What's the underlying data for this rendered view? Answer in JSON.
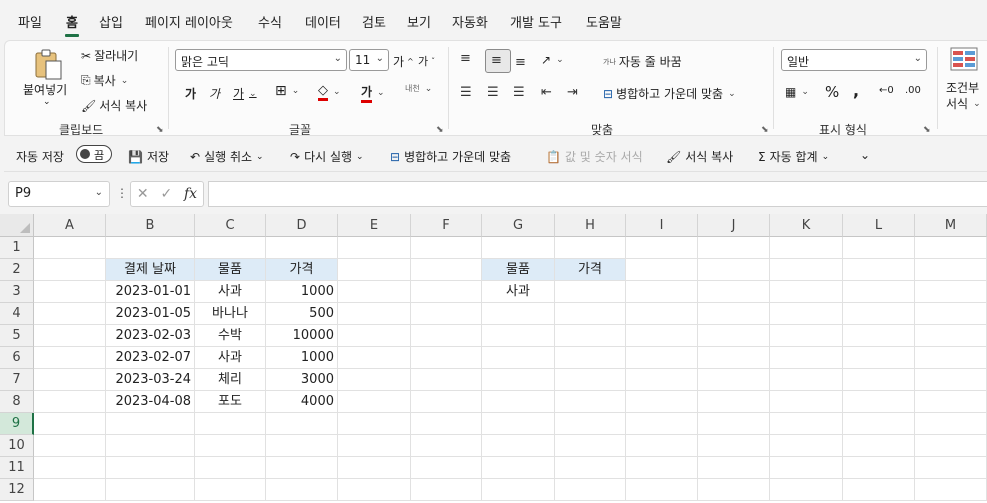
{
  "menu": {
    "tabs": [
      "파일",
      "홈",
      "삽입",
      "페이지 레이아웃",
      "수식",
      "데이터",
      "검토",
      "보기",
      "자동화",
      "개발 도구",
      "도움말"
    ],
    "active_tab": "홈"
  },
  "ribbon": {
    "clipboard": {
      "paste": "붙여넣기",
      "cut": "잘라내기",
      "copy": "복사",
      "format_painter": "서식 복사",
      "group": "클립보드"
    },
    "font": {
      "name": "맑은 고딕",
      "size": "11",
      "group": "글꼴",
      "bold": "가",
      "italic": "가",
      "underline": "가",
      "grow": "가",
      "shrink": "가",
      "fontcolor": "가",
      "phonetic": "내천"
    },
    "alignment": {
      "wrap": "자동 줄 바꿈",
      "merge": "병합하고 가운데 맞춤",
      "group": "맞춤",
      "wrap_hint": "가나"
    },
    "number": {
      "format": "일반",
      "group": "표시 형식"
    },
    "styles": {
      "conditional": "조건부",
      "conditional2": "서식"
    }
  },
  "qat": {
    "autosave": "자동 저장",
    "autosave_state": "끔",
    "save": "저장",
    "undo": "실행 취소",
    "redo": "다시 실행",
    "merge": "병합하고 가운데 맞춤",
    "number_format": "값 및 숫자 서식",
    "format_painter": "서식 복사",
    "autosum": "자동 합계"
  },
  "formula_bar": {
    "name_box": "P9",
    "formula": ""
  },
  "sheet": {
    "columns": [
      "A",
      "B",
      "C",
      "D",
      "E",
      "F",
      "G",
      "H",
      "I",
      "J",
      "K",
      "L",
      "M"
    ],
    "rows": [
      "1",
      "2",
      "3",
      "4",
      "5",
      "6",
      "7",
      "8",
      "9",
      "10",
      "11",
      "12"
    ],
    "selected_row": "9",
    "table1": {
      "headers": [
        "결제 날짜",
        "물품",
        "가격"
      ],
      "rows": [
        [
          "2023-01-01",
          "사과",
          "1000"
        ],
        [
          "2023-01-05",
          "바나나",
          "500"
        ],
        [
          "2023-02-03",
          "수박",
          "10000"
        ],
        [
          "2023-02-07",
          "사과",
          "1000"
        ],
        [
          "2023-03-24",
          "체리",
          "3000"
        ],
        [
          "2023-04-08",
          "포도",
          "4000"
        ]
      ]
    },
    "table2": {
      "headers": [
        "물품",
        "가격"
      ],
      "rows": [
        [
          "사과",
          ""
        ]
      ]
    }
  },
  "colors": {
    "accent": "#1e7145",
    "header_fill": "#ddebf7"
  }
}
